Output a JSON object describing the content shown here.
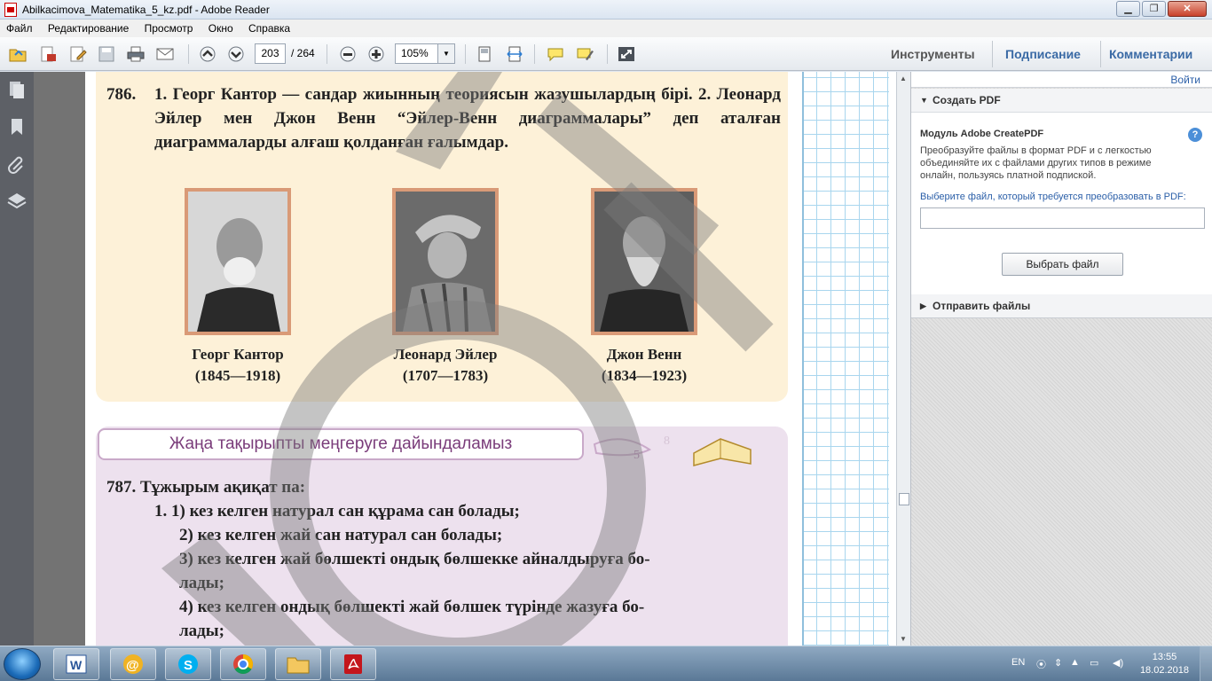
{
  "window": {
    "title": "Abilkacimova_Matematika_5_kz.pdf - Adobe Reader",
    "buttons": {
      "minimize": "▁",
      "maximize": "❐",
      "close": "✕"
    }
  },
  "menu": [
    "Файл",
    "Редактирование",
    "Просмотр",
    "Окно",
    "Справка"
  ],
  "toolbar": {
    "page_current": "203",
    "page_total": "/ 264",
    "zoom": "105%",
    "zoom_arrow": "▼",
    "tabs": {
      "tools": "Инструменты",
      "sign": "Подписание",
      "comments": "Комментарии"
    }
  },
  "document": {
    "ex786_number": "786.",
    "ex786_text": "1. Георг Кантор — сандар жиынның теориясын жазушылардың бірі. 2. Леонард Эйлер мен Джон Венн “Эйлер-Венн диаграммалары” деп аталған диаграммаларды алғаш қолданған ғалымдар.",
    "people": [
      {
        "name": "Георг Кантор",
        "years": "(1845—1918)"
      },
      {
        "name": "Леонард Эйлер",
        "years": "(1707—1783)"
      },
      {
        "name": "Джон Венн",
        "years": "(1834—1923)"
      }
    ],
    "heading": "Жаңа тақырыпты меңгеруге дайындаламыз",
    "ex787_title": "787. Тұжырым ақиқат па:",
    "ex787_lines": [
      "1. 1) кез келген натурал сан құрама сан болады;",
      "2) кез келген жай сан натурал сан болады;",
      "3) кез келген жай бөлшекті ондық бөлшекке айналдыруға бо-",
      "лады;",
      "4) кез келген ондық бөлшекті жай бөлшек түрінде жазуға бо-",
      "лады;"
    ]
  },
  "right_panel": {
    "done": "Войти",
    "create_pdf": "Создать PDF",
    "module_title": "Модуль Adobe CreatePDF",
    "help": "?",
    "description": "Преобразуйте файлы в формат PDF и с легкостью объединяйте их с файлами других типов в режиме онлайн, пользуясь платной подпиской.",
    "select_label": "Выберите файл, который требуется преобразовать в PDF:",
    "select_button": "Выбрать файл",
    "send_files": "Отправить файлы"
  },
  "taskbar": {
    "lang": "EN",
    "time": "13:55",
    "date": "18.02.2018"
  },
  "colors": {
    "box_yellow": "#fdf1d8",
    "box_purple": "#ede1ee",
    "photo_frame": "#d99a77",
    "link_blue": "#2b5fa8",
    "heading_purple": "#7a3c7a"
  }
}
